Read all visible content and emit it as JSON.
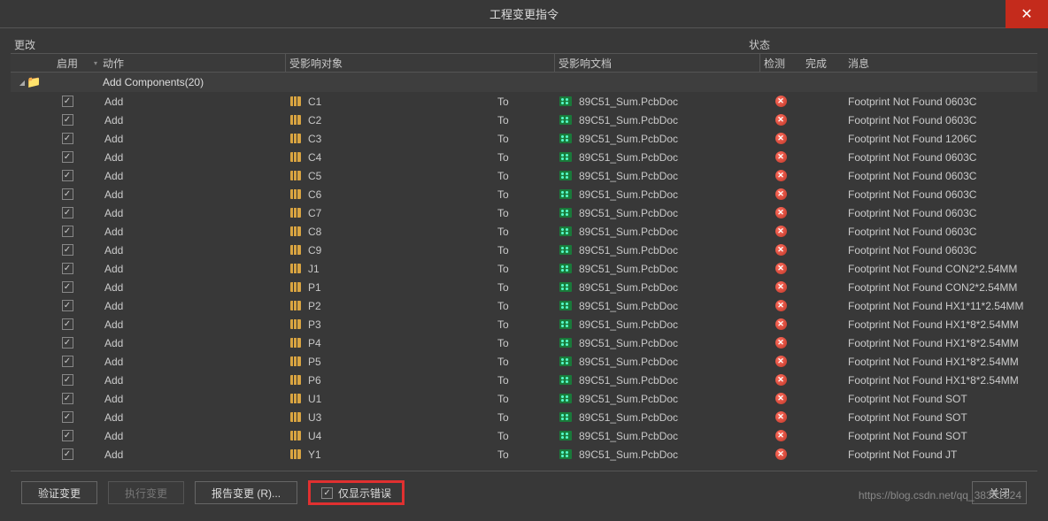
{
  "dialog": {
    "title": "工程变更指令"
  },
  "sections": {
    "changes": "更改",
    "status": "状态"
  },
  "columns": {
    "enable": "启用",
    "action": "动作",
    "object": "受影响对象",
    "doc": "受影响文档",
    "check": "检测",
    "done": "完成",
    "message": "消息"
  },
  "group": {
    "label": "Add Components(20)"
  },
  "to_label": "To",
  "doc_name": "89C51_Sum.PcbDoc",
  "rows": [
    {
      "action": "Add",
      "object": "C1",
      "message": "Footprint Not Found 0603C"
    },
    {
      "action": "Add",
      "object": "C2",
      "message": "Footprint Not Found 0603C"
    },
    {
      "action": "Add",
      "object": "C3",
      "message": "Footprint Not Found 1206C"
    },
    {
      "action": "Add",
      "object": "C4",
      "message": "Footprint Not Found 0603C"
    },
    {
      "action": "Add",
      "object": "C5",
      "message": "Footprint Not Found 0603C"
    },
    {
      "action": "Add",
      "object": "C6",
      "message": "Footprint Not Found 0603C"
    },
    {
      "action": "Add",
      "object": "C7",
      "message": "Footprint Not Found 0603C"
    },
    {
      "action": "Add",
      "object": "C8",
      "message": "Footprint Not Found 0603C"
    },
    {
      "action": "Add",
      "object": "C9",
      "message": "Footprint Not Found 0603C"
    },
    {
      "action": "Add",
      "object": "J1",
      "message": "Footprint Not Found CON2*2.54MM"
    },
    {
      "action": "Add",
      "object": "P1",
      "message": "Footprint Not Found CON2*2.54MM"
    },
    {
      "action": "Add",
      "object": "P2",
      "message": "Footprint Not Found HX1*11*2.54MM"
    },
    {
      "action": "Add",
      "object": "P3",
      "message": "Footprint Not Found HX1*8*2.54MM"
    },
    {
      "action": "Add",
      "object": "P4",
      "message": "Footprint Not Found HX1*8*2.54MM"
    },
    {
      "action": "Add",
      "object": "P5",
      "message": "Footprint Not Found HX1*8*2.54MM"
    },
    {
      "action": "Add",
      "object": "P6",
      "message": "Footprint Not Found HX1*8*2.54MM"
    },
    {
      "action": "Add",
      "object": "U1",
      "message": "Footprint Not Found SOT"
    },
    {
      "action": "Add",
      "object": "U3",
      "message": "Footprint Not Found SOT"
    },
    {
      "action": "Add",
      "object": "U4",
      "message": "Footprint Not Found SOT"
    },
    {
      "action": "Add",
      "object": "Y1",
      "message": "Footprint Not Found JT"
    }
  ],
  "buttons": {
    "validate": "验证变更",
    "execute": "执行变更",
    "report": "报告变更 (R)...",
    "show_errors": "仅显示错误",
    "close": "关闭"
  },
  "watermark": "https://blog.csdn.net/qq_38351824"
}
